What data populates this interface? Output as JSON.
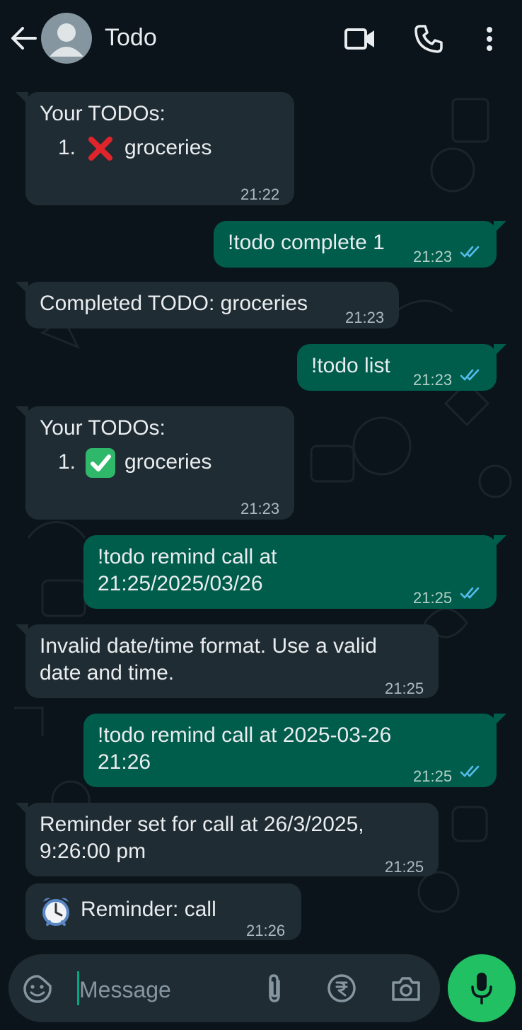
{
  "header": {
    "title": "Todo",
    "icons": [
      "back-arrow-icon",
      "avatar",
      "video-call-icon",
      "voice-call-icon",
      "more-options-icon"
    ]
  },
  "messages": [
    {
      "dir": "in",
      "lines": [
        "Your TODOs:"
      ],
      "list_item": {
        "number": "1.",
        "mark": "cross-mark-icon",
        "text": "groceries"
      },
      "time": "21:22"
    },
    {
      "dir": "out",
      "lines": [
        "!todo complete 1"
      ],
      "time": "21:23",
      "status": "read"
    },
    {
      "dir": "in",
      "lines": [
        "Completed TODO: groceries"
      ],
      "time": "21:23"
    },
    {
      "dir": "out",
      "lines": [
        "!todo list"
      ],
      "time": "21:23",
      "status": "read"
    },
    {
      "dir": "in",
      "lines": [
        "Your TODOs:"
      ],
      "list_item": {
        "number": "1.",
        "mark": "check-mark-icon",
        "text": "groceries"
      },
      "time": "21:23"
    },
    {
      "dir": "out",
      "lines": [
        "!todo remind call at",
        "21:25/2025/03/26"
      ],
      "time": "21:25",
      "status": "read"
    },
    {
      "dir": "in",
      "lines": [
        "Invalid date/time format. Use a valid",
        "date and time."
      ],
      "time": "21:25"
    },
    {
      "dir": "out",
      "lines": [
        "!todo remind call at 2025-03-26",
        "21:26"
      ],
      "time": "21:25",
      "status": "read"
    },
    {
      "dir": "in",
      "lines": [
        "Reminder set for call at 26/3/2025,",
        "9:26:00 pm"
      ],
      "time": "21:25"
    },
    {
      "dir": "in",
      "prefix_icon": "alarm-clock-icon",
      "lines": [
        "Reminder: call"
      ],
      "time": "21:26"
    }
  ],
  "composer": {
    "placeholder": "Message",
    "icons": [
      "emoji-sticker-icon",
      "attach-icon",
      "rupee-payment-icon",
      "camera-icon",
      "mic-icon"
    ]
  },
  "colors": {
    "background": "#0b141a",
    "incoming_bubble": "#202c33",
    "outgoing_bubble": "#005c4b",
    "read_ticks": "#53bdeb",
    "mic_button": "#21c063",
    "cross_mark": "#e0242b",
    "check_box": "#2fb76a"
  }
}
